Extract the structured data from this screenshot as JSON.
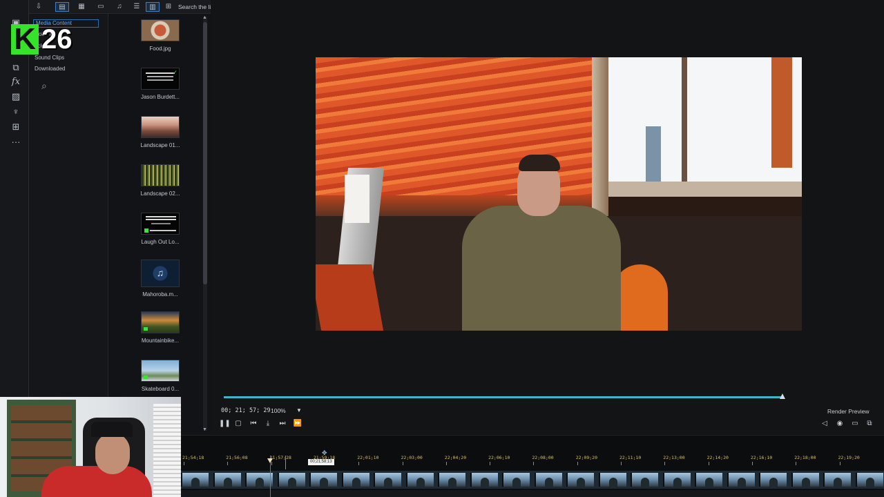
{
  "app": {
    "colors": {
      "accent": "#3fb6c8",
      "selection": "#2d6fb0",
      "playhead": "#e04848",
      "ruler_text": "#d6c068"
    }
  },
  "library_toolbar": {
    "buttons": [
      "import-icon",
      "media-type-video-icon",
      "storyboard-icon",
      "image-icon",
      "music-icon",
      "list-view-icon",
      "grid-view-icon",
      "grid-small-icon"
    ],
    "search_placeholder": "Search the li"
  },
  "library_tree": {
    "items": [
      "Media Content",
      "Color Bo",
      "ackgr",
      "Sound Clips",
      "Downloaded"
    ],
    "selected": "Media Content"
  },
  "media_items": [
    {
      "label": "Food.jpg",
      "thumb": "food"
    },
    {
      "label": "Jason Burdett...",
      "thumb": "text-dark"
    },
    {
      "label": "Landscape 01...",
      "thumb": "landscape1"
    },
    {
      "label": "Landscape 02...",
      "thumb": "forest"
    },
    {
      "label": "Laugh Out Lo...",
      "thumb": "text-dark"
    },
    {
      "label": "Mahoroba.m...",
      "thumb": "music"
    },
    {
      "label": "Mountainbike...",
      "thumb": "mountain"
    },
    {
      "label": "Skateboard 0...",
      "thumb": "skate"
    }
  ],
  "preview": {
    "timecode": "00; 21; 57; 29",
    "zoom": "100%",
    "render_label": "Render Preview",
    "progress": 0.998
  },
  "timeline": {
    "ticks": [
      "21;54;18",
      "21;56;08",
      "21;57;28",
      "21;59;18",
      "22;01;10",
      "22;03;00",
      "22;04;20",
      "22;06;10",
      "22;08;00",
      "22;09;20",
      "22;11;10",
      "22;13;00",
      "22;14;20",
      "22;16;10",
      "22;18;00",
      "22;19;20"
    ],
    "tooltip": "00;21;58;13"
  },
  "overlay": {
    "badge_letter": "K",
    "badge_number": "26"
  }
}
